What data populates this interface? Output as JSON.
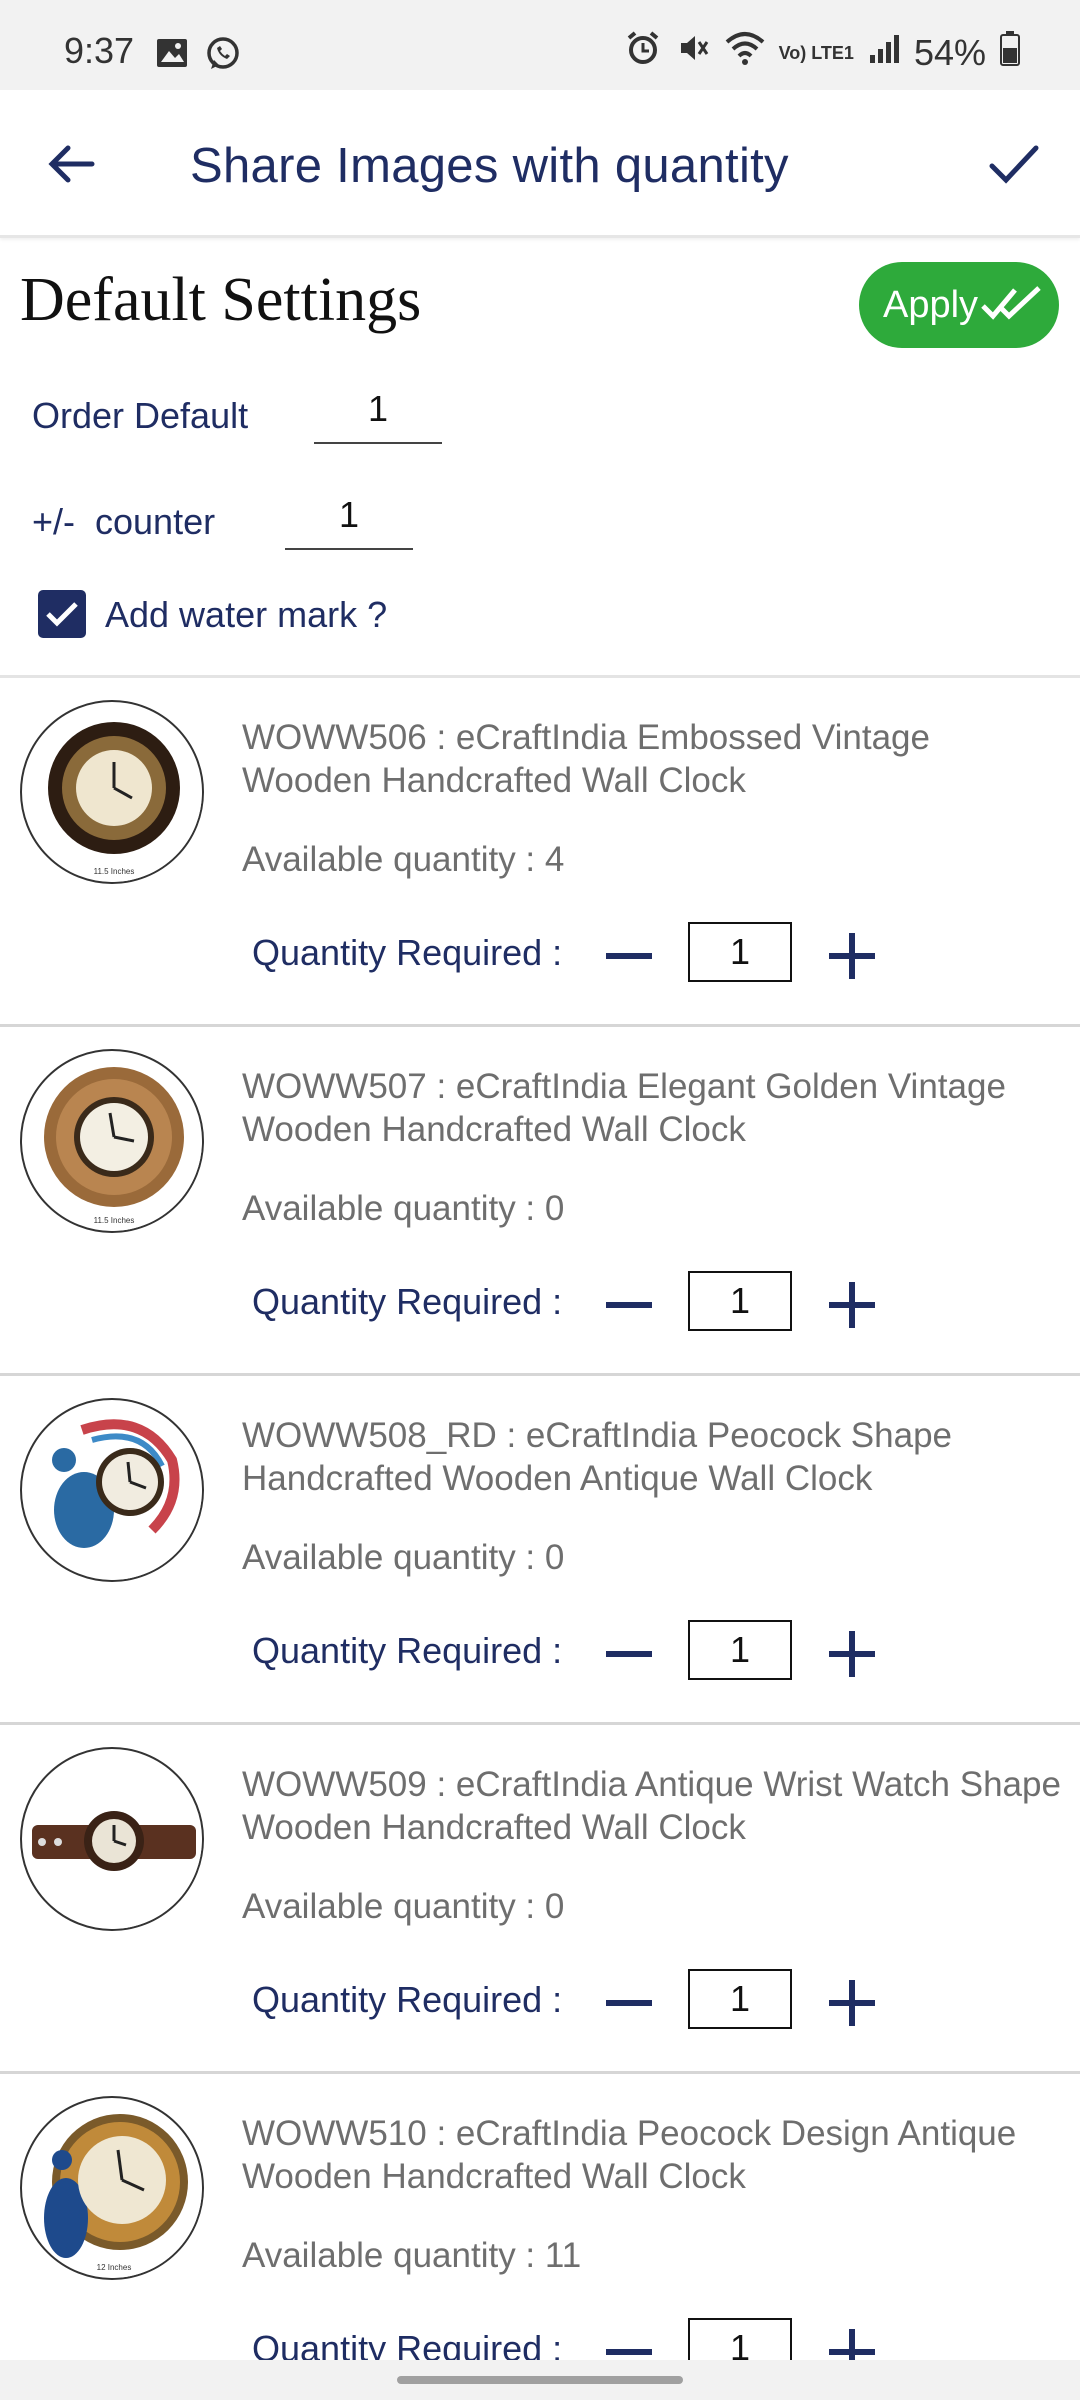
{
  "status_bar": {
    "time": "9:37",
    "battery": "54%",
    "lte_label": "Vo) LTE1"
  },
  "app_bar": {
    "title": "Share Images with quantity"
  },
  "settings": {
    "title": "Default Settings",
    "apply_label": "Apply",
    "order_default_label": "Order Default",
    "order_default_value": "1",
    "counter_label": "+/-  counter",
    "counter_value": "1",
    "watermark_label": "Add water mark ?",
    "watermark_checked": true
  },
  "products": [
    {
      "name": "WOWW506 : eCraftIndia Embossed Vintage Wooden Handcrafted Wall Clock",
      "available": "Available quantity : 4",
      "qty_label": "Quantity Required :",
      "qty": "1",
      "image": "clock-embossed-vintage"
    },
    {
      "name": "WOWW507 : eCraftIndia Elegant Golden Vintage Wooden Handcrafted Wall Clock",
      "available": "Available quantity : 0",
      "qty_label": "Quantity Required :",
      "qty": "1",
      "image": "clock-golden-vintage"
    },
    {
      "name": "WOWW508_RD : eCraftIndia Peocock Shape Handcrafted Wooden Antique Wall Clock",
      "available": "Available quantity : 0",
      "qty_label": "Quantity Required :",
      "qty": "1",
      "image": "clock-peacock-shape"
    },
    {
      "name": "WOWW509 : eCraftIndia Antique Wrist Watch Shape Wooden Handcrafted Wall Clock",
      "available": "Available quantity : 0",
      "qty_label": "Quantity Required :",
      "qty": "1",
      "image": "clock-wrist-watch"
    },
    {
      "name": "WOWW510 : eCraftIndia Peocock Design Antique Wooden Handcrafted Wall Clock",
      "available": "Available quantity : 11",
      "qty_label": "Quantity Required :",
      "qty": "1",
      "image": "clock-peacock-design"
    }
  ],
  "colors": {
    "primary": "#1f2d63",
    "apply_green": "#2eaa3b",
    "muted_text": "#6e6e6e"
  }
}
